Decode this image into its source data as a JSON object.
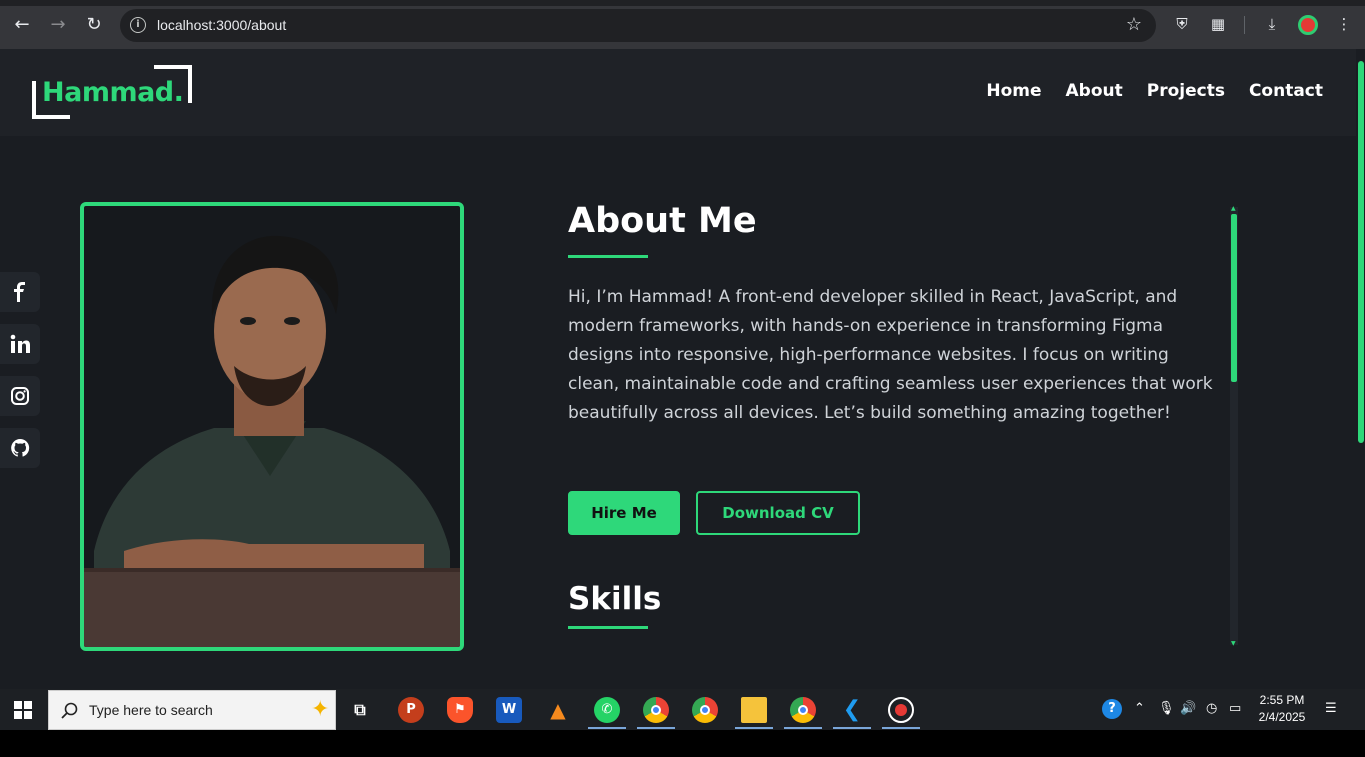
{
  "browser": {
    "url": "localhost:3000/about"
  },
  "site": {
    "logo_text": "Hammad.",
    "nav": [
      {
        "label": "Home"
      },
      {
        "label": "About"
      },
      {
        "label": "Projects"
      },
      {
        "label": "Contact"
      }
    ],
    "social": [
      "facebook-icon",
      "linkedin-icon",
      "instagram-icon",
      "github-icon"
    ]
  },
  "about": {
    "title": "About Me",
    "bio": "Hi, I’m Hammad! A front-end developer skilled in React, JavaScript, and modern frameworks, with hands-on experience in transforming Figma designs into responsive, high-performance websites. I focus on writing clean, maintainable code and crafting seamless user experiences that work beautifully across all devices. Let’s build something amazing together!",
    "hire_label": "Hire Me",
    "cv_label": "Download CV",
    "skills_title": "Skills"
  },
  "taskbar": {
    "search_placeholder": "Type here to search",
    "time": "2:55 PM",
    "date": "2/4/2025"
  },
  "colors": {
    "accent": "#2ed87a",
    "background": "#1a1d22"
  }
}
